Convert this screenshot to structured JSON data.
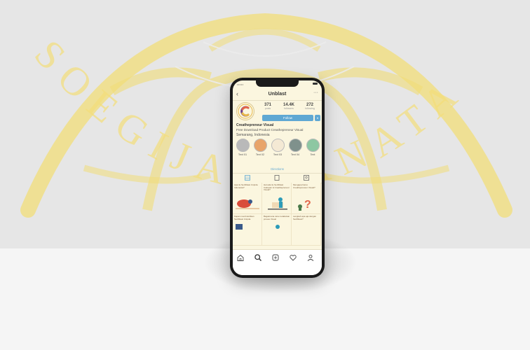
{
  "profile": {
    "title": "Unblast",
    "name": "Creathepreneur Visual",
    "bio_line1": "Free Download Product Creathepreneur Visual",
    "bio_line2": "Semarang, Indonesia",
    "follow_label": "Follow",
    "stats": [
      {
        "value": "371",
        "label": "posts"
      },
      {
        "value": "14.4K",
        "label": "followers"
      },
      {
        "value": "272",
        "label": "following"
      }
    ],
    "avatar_letter": "C"
  },
  "highlights": [
    {
      "label": "Text 01",
      "color": "#b9b9b9"
    },
    {
      "label": "Text 02",
      "color": "#e8a46a"
    },
    {
      "label": "Text 03",
      "color": "#f4e9d4"
    },
    {
      "label": "Text 04",
      "color": "#7f918c"
    },
    {
      "label": "Text",
      "color": "#8dc7a2"
    }
  ],
  "directions_label": "Directions",
  "tabs": [
    {
      "icon": "grid-icon"
    },
    {
      "icon": "feed-icon"
    },
    {
      "icon": "tagged-icon"
    }
  ],
  "posts": [
    {
      "caption": "Apa itu Sertifikasi Unipda Indonesia?"
    },
    {
      "caption": "Hal ada itu Sertifikasi Cakupan & Creathepreneur Visual?"
    },
    {
      "caption": "Mengapa harus Creathepreneur Visual?"
    },
    {
      "caption": "Kapan membutuhkan Sertifikasi Unipda"
    },
    {
      "caption": "Bagaimana cara melakukan proses Visual"
    },
    {
      "caption": "Langkah apa aja dengan Sertifikasi?"
    }
  ],
  "bottom_nav": [
    {
      "icon": "home-icon"
    },
    {
      "icon": "search-icon"
    },
    {
      "icon": "add-post-icon"
    },
    {
      "icon": "heart-icon"
    },
    {
      "icon": "profile-icon"
    }
  ],
  "watermark": {
    "text": "SOEGIJAPRANATA",
    "color": "#f4de7a"
  },
  "colors": {
    "accent": "#5fa8d3",
    "screen_bg": "#fbf6df"
  }
}
